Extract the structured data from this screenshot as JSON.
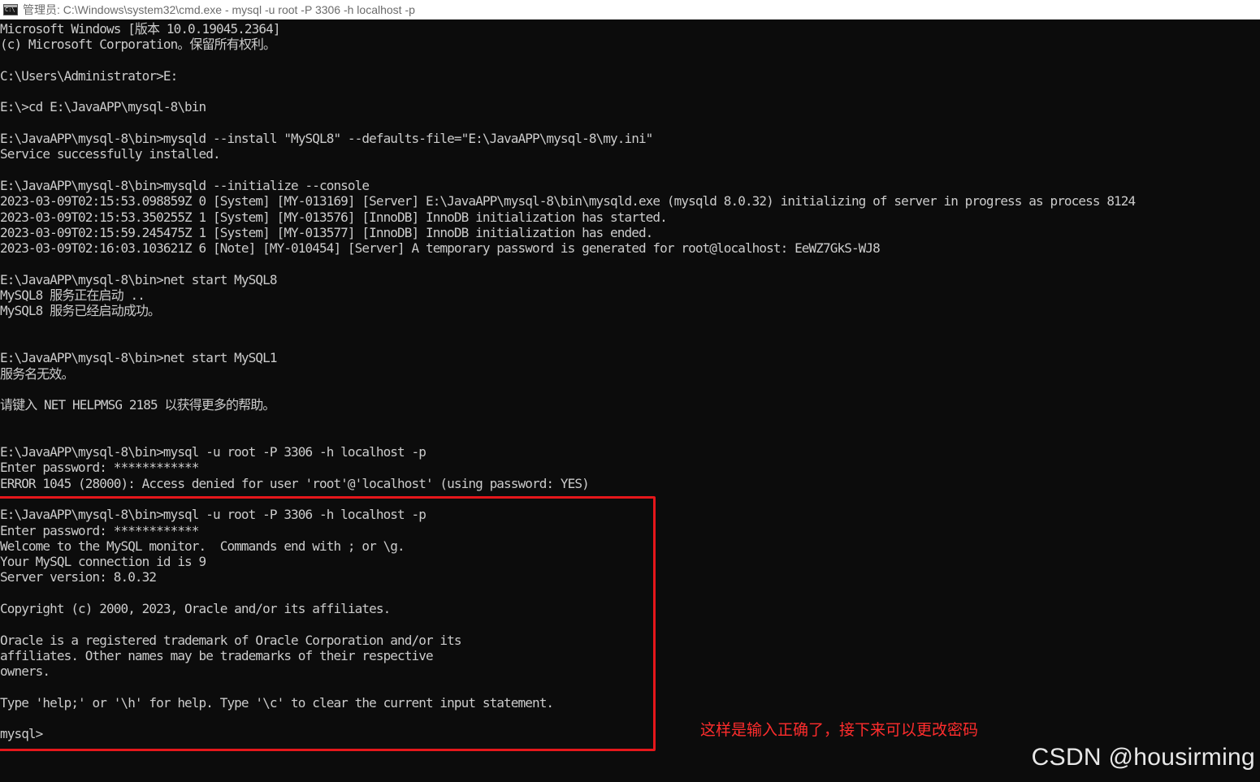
{
  "window": {
    "title": "管理员: C:\\Windows\\system32\\cmd.exe - mysql  -u root -P 3306 -h localhost -p",
    "icon": "cmd-icon"
  },
  "console": {
    "lines": [
      "Microsoft Windows [版本 10.0.19045.2364]",
      "(c) Microsoft Corporation。保留所有权利。",
      "",
      "C:\\Users\\Administrator>E:",
      "",
      "E:\\>cd E:\\JavaAPP\\mysql-8\\bin",
      "",
      "E:\\JavaAPP\\mysql-8\\bin>mysqld --install \"MySQL8\" --defaults-file=\"E:\\JavaAPP\\mysql-8\\my.ini\"",
      "Service successfully installed.",
      "",
      "E:\\JavaAPP\\mysql-8\\bin>mysqld --initialize --console",
      "2023-03-09T02:15:53.098859Z 0 [System] [MY-013169] [Server] E:\\JavaAPP\\mysql-8\\bin\\mysqld.exe (mysqld 8.0.32) initializing of server in progress as process 8124",
      "2023-03-09T02:15:53.350255Z 1 [System] [MY-013576] [InnoDB] InnoDB initialization has started.",
      "2023-03-09T02:15:59.245475Z 1 [System] [MY-013577] [InnoDB] InnoDB initialization has ended.",
      "2023-03-09T02:16:03.103621Z 6 [Note] [MY-010454] [Server] A temporary password is generated for root@localhost: EeWZ7GkS-WJ8",
      "",
      "E:\\JavaAPP\\mysql-8\\bin>net start MySQL8",
      "MySQL8 服务正在启动 ..",
      "MySQL8 服务已经启动成功。",
      "",
      "",
      "E:\\JavaAPP\\mysql-8\\bin>net start MySQL1",
      "服务名无效。",
      "",
      "请键入 NET HELPMSG 2185 以获得更多的帮助。",
      "",
      "",
      "E:\\JavaAPP\\mysql-8\\bin>mysql -u root -P 3306 -h localhost -p",
      "Enter password: ************",
      "ERROR 1045 (28000): Access denied for user 'root'@'localhost' (using password: YES)",
      "",
      "E:\\JavaAPP\\mysql-8\\bin>mysql -u root -P 3306 -h localhost -p",
      "Enter password: ************",
      "Welcome to the MySQL monitor.  Commands end with ; or \\g.",
      "Your MySQL connection id is 9",
      "Server version: 8.0.32",
      "",
      "Copyright (c) 2000, 2023, Oracle and/or its affiliates.",
      "",
      "Oracle is a registered trademark of Oracle Corporation and/or its",
      "affiliates. Other names may be trademarks of their respective",
      "owners.",
      "",
      "Type 'help;' or '\\h' for help. Type '\\c' to clear the current input statement.",
      "",
      "mysql>"
    ]
  },
  "annotation": {
    "text": "这样是输入正确了，接下来可以更改密码",
    "color": "#ff2d2d"
  },
  "watermark": {
    "text": "CSDN @housirming"
  },
  "colors": {
    "background": "#0c0c0c",
    "text": "#cccccc",
    "highlight_border": "#e5171b"
  }
}
